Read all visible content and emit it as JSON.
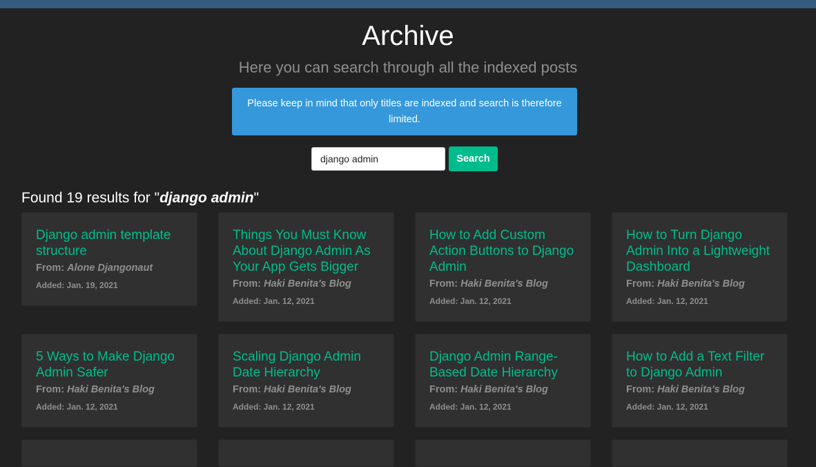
{
  "header": {
    "title": "Archive",
    "subtitle": "Here you can search through all the indexed posts"
  },
  "notice": {
    "text": "Please keep in mind that only titles are indexed and search is therefore limited."
  },
  "search": {
    "value": "django admin",
    "button_label": "Search"
  },
  "results": {
    "prefix": "Found 19 results for \"",
    "query": "django admin",
    "suffix": "\""
  },
  "from_label": "From:",
  "added_label": "Added:",
  "posts": [
    {
      "title": "Django admin template structure",
      "source": "Alone Djangonaut",
      "added": "Jan. 19, 2021"
    },
    {
      "title": "Things You Must Know About Django Admin As Your App Gets Bigger",
      "source": "Haki Benita's Blog",
      "added": "Jan. 12, 2021"
    },
    {
      "title": "How to Add Custom Action Buttons to Django Admin",
      "source": "Haki Benita's Blog",
      "added": "Jan. 12, 2021"
    },
    {
      "title": "How to Turn Django Admin Into a Lightweight Dashboard",
      "source": "Haki Benita's Blog",
      "added": "Jan. 12, 2021"
    },
    {
      "title": "5 Ways to Make Django Admin Safer",
      "source": "Haki Benita's Blog",
      "added": "Jan. 12, 2021"
    },
    {
      "title": "Scaling Django Admin Date Hierarchy",
      "source": "Haki Benita's Blog",
      "added": "Jan. 12, 2021"
    },
    {
      "title": "Django Admin Range-Based Date Hierarchy",
      "source": "Haki Benita's Blog",
      "added": "Jan. 12, 2021"
    },
    {
      "title": "How to Add a Text Filter to Django Admin",
      "source": "Haki Benita's Blog",
      "added": "Jan. 12, 2021"
    }
  ]
}
